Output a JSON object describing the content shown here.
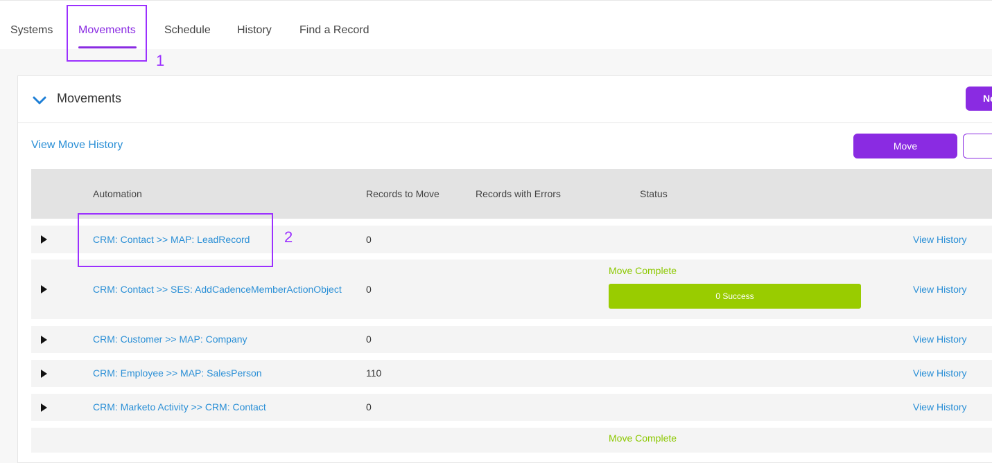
{
  "tabs": [
    {
      "label": "Systems"
    },
    {
      "label": "Movements"
    },
    {
      "label": "Schedule"
    },
    {
      "label": "History"
    },
    {
      "label": "Find a Record"
    }
  ],
  "active_tab": "Movements",
  "annotations": [
    "1",
    "2"
  ],
  "panel": {
    "title": "Movements",
    "new_button_label": "Ne",
    "view_move_history": "View Move History",
    "move_button": "Move"
  },
  "table": {
    "headers": [
      "Automation",
      "Records to Move",
      "Records with Errors",
      "Status"
    ],
    "rows": [
      {
        "automation": "CRM: Contact >> MAP: LeadRecord",
        "records_to_move": "0",
        "status_text": "",
        "status_bar": "",
        "action": "View History"
      },
      {
        "automation": "CRM: Contact >> SES: AddCadenceMemberActionObject",
        "records_to_move": "0",
        "status_text": "Move Complete",
        "status_bar": "0 Success",
        "action": "View History"
      },
      {
        "automation": "CRM: Customer >> MAP: Company",
        "records_to_move": "0",
        "status_text": "",
        "status_bar": "",
        "action": "View History"
      },
      {
        "automation": "CRM: Employee >> MAP: SalesPerson",
        "records_to_move": "110",
        "status_text": "",
        "status_bar": "",
        "action": "View History"
      },
      {
        "automation": "CRM: Marketo Activity >> CRM: Contact",
        "records_to_move": "0",
        "status_text": "",
        "status_bar": "",
        "action": "View History"
      },
      {
        "automation": "",
        "records_to_move": "",
        "status_text": "Move Complete",
        "status_bar": "",
        "action": ""
      }
    ]
  },
  "colors": {
    "accent": "#8a2be2",
    "link": "#2a8fd6",
    "success": "#99cc00",
    "annotation": "#9b30ff"
  },
  "icons": {
    "collapse": "chevron-down-icon",
    "expand_row": "play-triangle-icon"
  }
}
